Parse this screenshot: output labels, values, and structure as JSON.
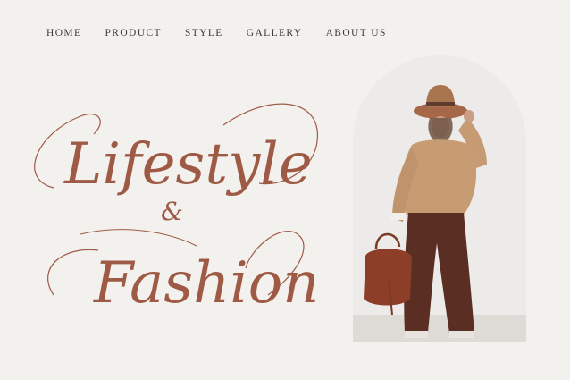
{
  "nav": {
    "items": [
      {
        "label": "HOME"
      },
      {
        "label": "PRODUCT"
      },
      {
        "label": "STYLE"
      },
      {
        "label": "GALLERY"
      },
      {
        "label": "ABOUT US"
      }
    ]
  },
  "hero": {
    "line1": "Lifestyle",
    "ampersand": "&",
    "line2": "Fashion"
  },
  "colors": {
    "background": "#f3f1ee",
    "accent": "#9e5a45",
    "nav_text": "#3f3a36"
  }
}
